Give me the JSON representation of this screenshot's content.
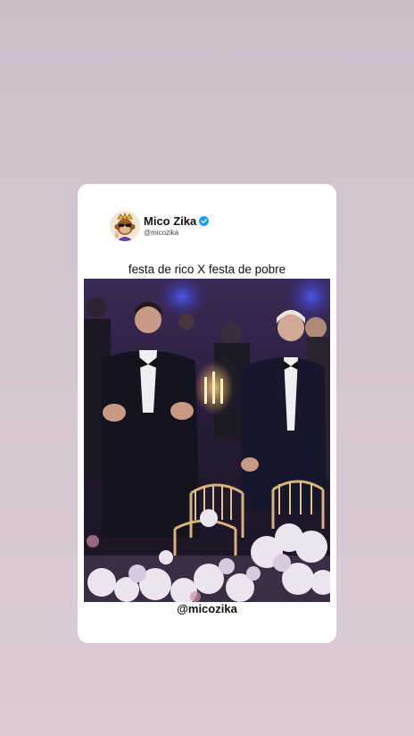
{
  "post": {
    "display_name": "Mico Zika",
    "handle": "@micozika",
    "caption": "festa de rico X festa de pobre",
    "watermark": "@micozika"
  },
  "icons": {
    "avatar": "monkey-king-avatar-icon",
    "verified": "verified-badge-icon"
  },
  "colors": {
    "background": "#d6c6d2",
    "card": "#ffffff",
    "verified": "#1d9bf0"
  }
}
